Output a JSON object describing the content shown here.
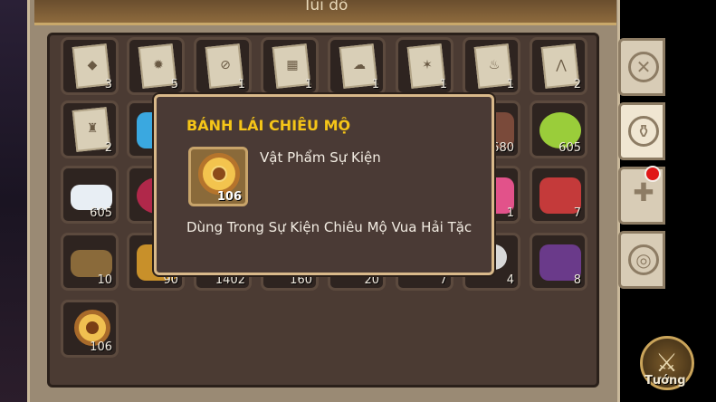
{
  "window": {
    "title": "Túi đồ"
  },
  "grid": {
    "row1": [
      "3",
      "5",
      "1",
      "1",
      "1",
      "1",
      "1",
      "2"
    ],
    "row2": [
      "2",
      "",
      "",
      "",
      "",
      "",
      "680",
      "605"
    ],
    "row3": [
      "605",
      "",
      "",
      "",
      "",
      "",
      "1",
      "7"
    ],
    "row4": [
      "10",
      "90",
      "1402",
      "160",
      "20",
      "7",
      "4",
      "8"
    ],
    "row5": [
      "106"
    ]
  },
  "tooltip": {
    "title": "BÁNH LÁI CHIÊU MỘ",
    "item_count": "106",
    "type": "Vật Phẩm Sự Kiện",
    "description": "Dùng Trong Sự Kiện Chiêu Mộ Vua Hải Tặc"
  },
  "side_tabs": [
    "shield-icon",
    "potion-icon",
    "puzzle-icon",
    "ring-icon"
  ],
  "hero_button": {
    "label": "Tướng"
  },
  "colors": {
    "title_accent": "#f5c518",
    "panel_bg": "#4b3b33",
    "notify": "#e01818"
  }
}
